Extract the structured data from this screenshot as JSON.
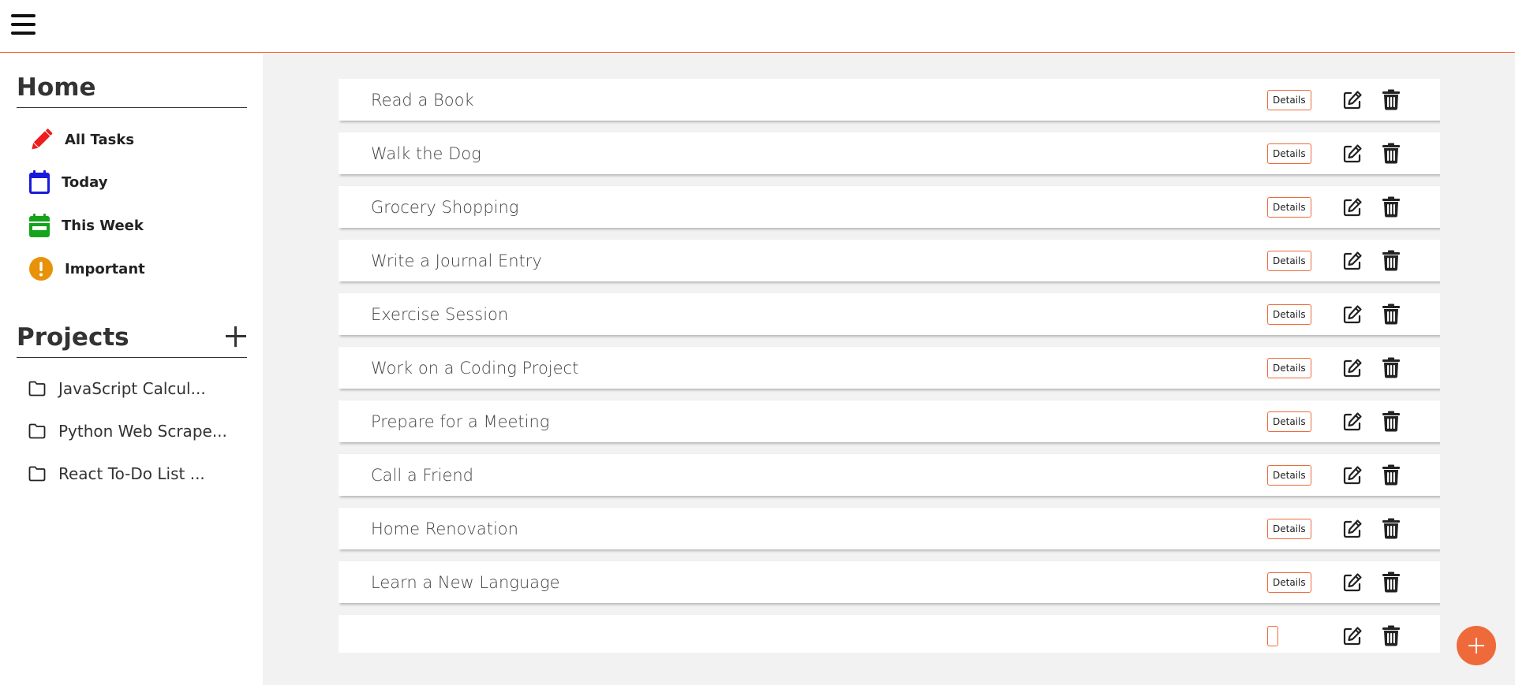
{
  "colors": {
    "accent": "#ee6a3a",
    "all_tasks_icon": "#ee1c1c",
    "today_icon": "#1a1adb",
    "this_week_icon": "#16a31c",
    "important_icon": "#e8920a"
  },
  "sidebar": {
    "home_title": "Home",
    "nav": [
      {
        "label": "All Tasks",
        "icon": "pencil-icon"
      },
      {
        "label": "Today",
        "icon": "calendar-icon"
      },
      {
        "label": "This Week",
        "icon": "calendar-week-icon"
      },
      {
        "label": "Important",
        "icon": "exclamation-circle-icon"
      }
    ],
    "projects_title": "Projects",
    "projects": [
      {
        "label": "JavaScript Calcul...",
        "icon": "folder-icon"
      },
      {
        "label": "Python Web Scrape...",
        "icon": "folder-icon"
      },
      {
        "label": "React To-Do List ...",
        "icon": "folder-icon"
      }
    ]
  },
  "tasks": [
    {
      "title": "Read a Book",
      "details_label": "Details"
    },
    {
      "title": "Walk the Dog",
      "details_label": "Details"
    },
    {
      "title": "Grocery Shopping",
      "details_label": "Details"
    },
    {
      "title": "Write a Journal Entry",
      "details_label": "Details"
    },
    {
      "title": "Exercise Session",
      "details_label": "Details"
    },
    {
      "title": "Work on a Coding Project",
      "details_label": "Details"
    },
    {
      "title": "Prepare for a Meeting",
      "details_label": "Details"
    },
    {
      "title": "Call a Friend",
      "details_label": "Details"
    },
    {
      "title": "Home Renovation",
      "details_label": "Details"
    },
    {
      "title": "Learn a New Language",
      "details_label": "Details"
    },
    {
      "title": "",
      "details_label": ""
    }
  ]
}
